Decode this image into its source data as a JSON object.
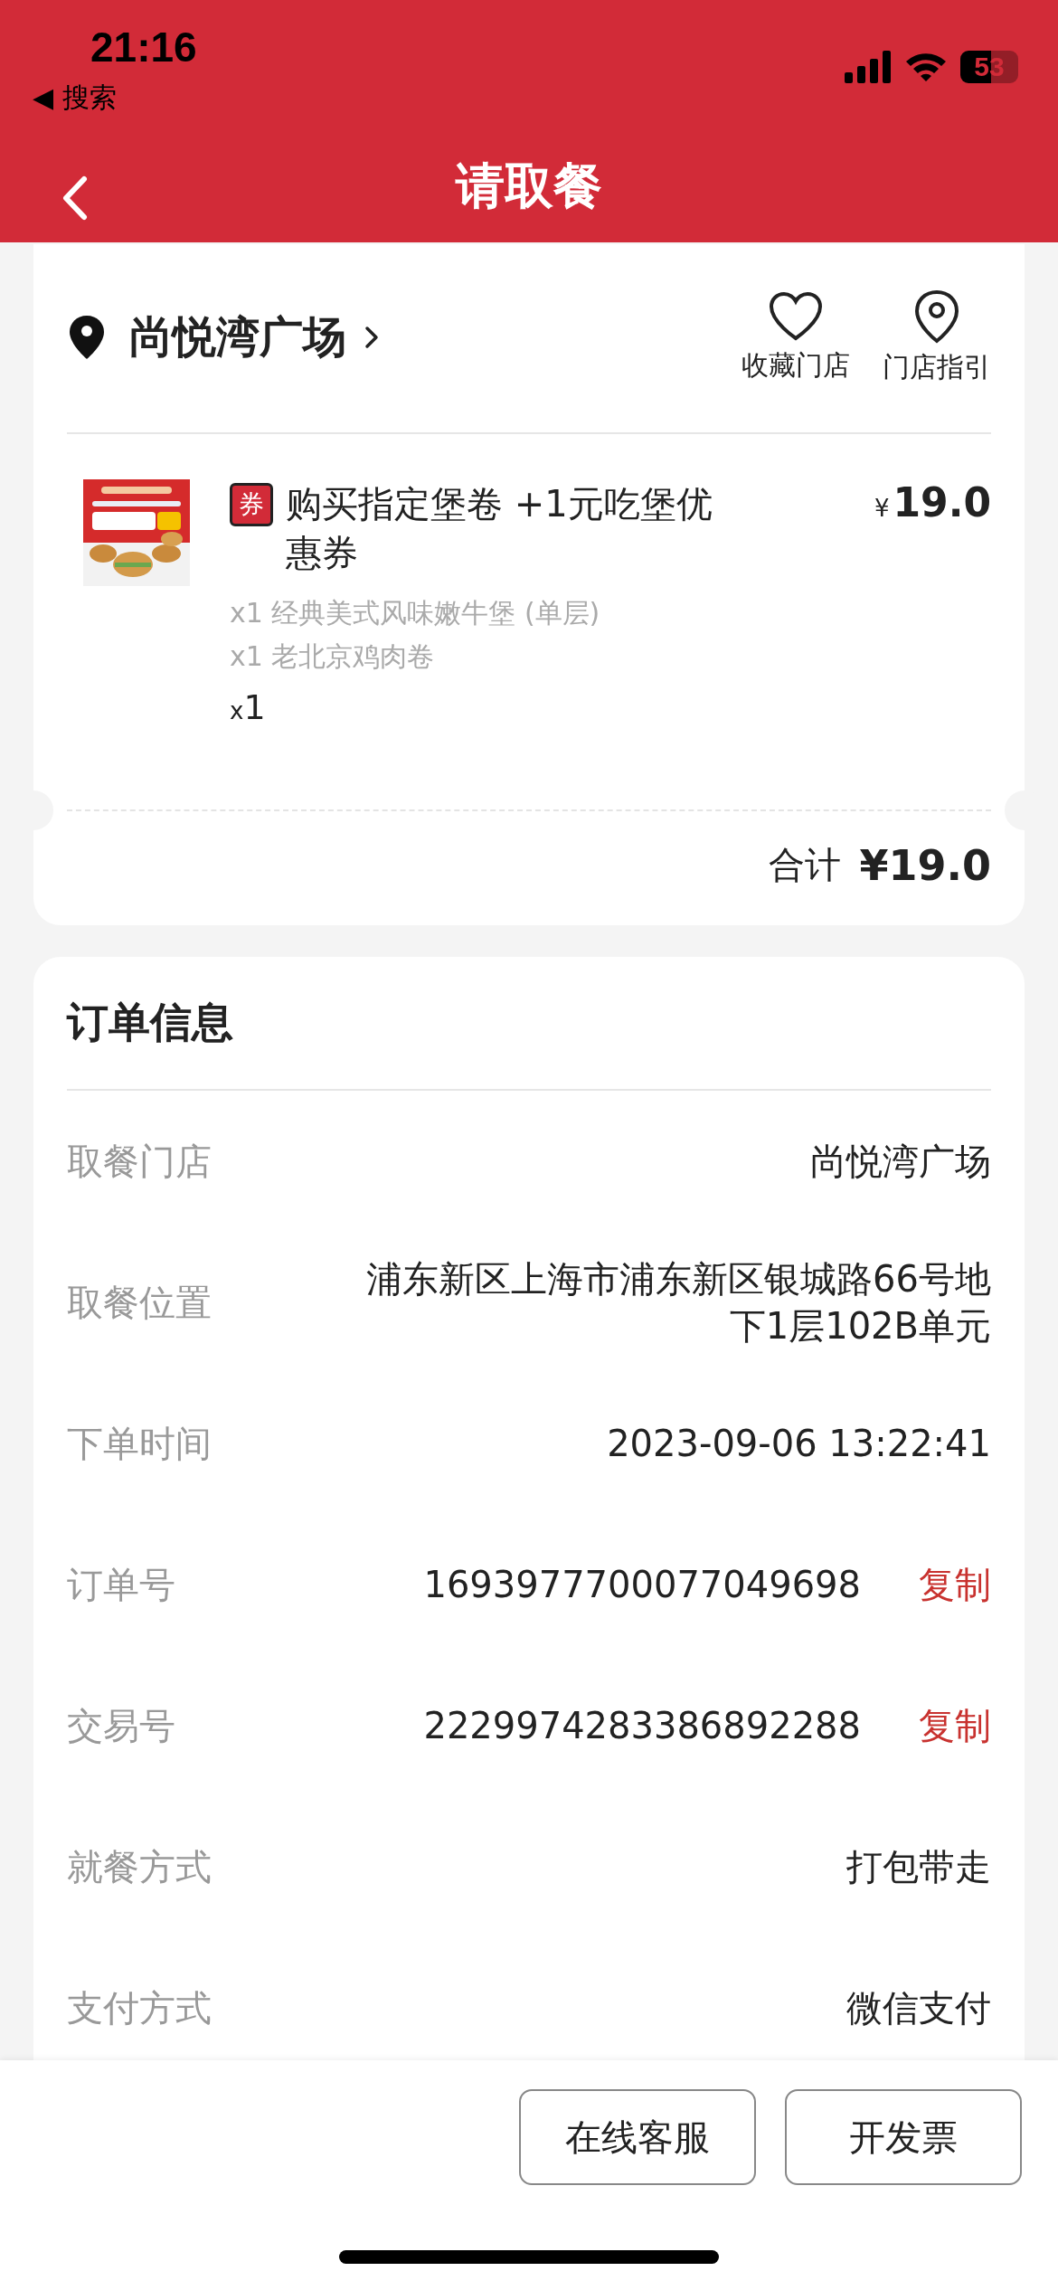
{
  "status_bar": {
    "time": "21:16",
    "back_app": "◀ 搜索",
    "battery": "53"
  },
  "nav": {
    "title": "请取餐"
  },
  "store": {
    "name": "尚悦湾广场",
    "actions": [
      "收藏门店",
      "门店指引"
    ]
  },
  "product": {
    "badge": "券",
    "name": "购买指定堡卷 +1元吃堡优惠券",
    "price_symbol": "¥",
    "price": "19.0",
    "items": [
      "x1 经典美式风味嫩牛堡 (单层)",
      "x1 老北京鸡肉卷"
    ],
    "qty_prefix": "x",
    "qty": "1"
  },
  "total": {
    "label": "合计",
    "amount": "¥19.0"
  },
  "order_info": {
    "title": "订单信息",
    "rows": [
      {
        "label": "取餐门店",
        "value": "尚悦湾广场"
      },
      {
        "label": "取餐位置",
        "value": "浦东新区上海市浦东新区银城路66号地下1层102B单元"
      },
      {
        "label": "下单时间",
        "value": "2023-09-06 13:22:41"
      },
      {
        "label": "订单号",
        "value": "1693977700077049698",
        "action": "复制"
      },
      {
        "label": "交易号",
        "value": "2229974283386892288",
        "action": "复制"
      },
      {
        "label": "就餐方式",
        "value": "打包带走"
      },
      {
        "label": "支付方式",
        "value": "微信支付"
      }
    ]
  },
  "buttons": [
    "在线客服",
    "开发票"
  ]
}
